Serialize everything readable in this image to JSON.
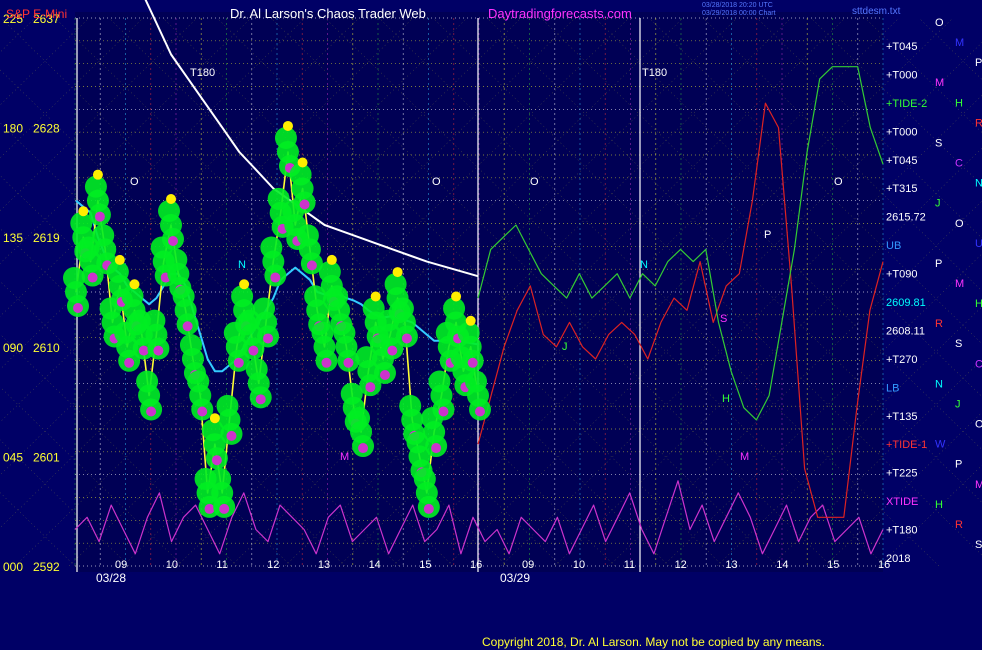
{
  "header": {
    "symbol": "S&P E-Mini",
    "title": "Dr. Al Larson's Chaos Trader Web",
    "site": "Daytradingforecasts.com",
    "stamp1": "03/28/2018 20:20 UTC",
    "stamp2": "03/29/2018 00:00 Chart",
    "file": "sttdesm.txt"
  },
  "footer": {
    "copyright": "Copyright 2018, Dr. Al Larson. May not be copied by any means."
  },
  "y_axis": [
    {
      "deg": "225",
      "price": "2637"
    },
    {
      "deg": "180",
      "price": "2628"
    },
    {
      "deg": "135",
      "price": "2619"
    },
    {
      "deg": "090",
      "price": "2610"
    },
    {
      "deg": "045",
      "price": "2601"
    },
    {
      "deg": "000",
      "price": "2592"
    }
  ],
  "x_axis": {
    "day1": "03/28",
    "day2": "03/29",
    "hours1": [
      "09",
      "10",
      "11",
      "12",
      "13",
      "14",
      "15",
      "16"
    ],
    "hours2": [
      "09",
      "10",
      "11",
      "12",
      "13",
      "14",
      "15",
      "16"
    ]
  },
  "right_labels": [
    {
      "text": "+T045",
      "color": "#ffffff"
    },
    {
      "text": "+T000",
      "color": "#ffffff"
    },
    {
      "text": "+TIDE-2",
      "color": "#33ff33"
    },
    {
      "text": "+T000",
      "color": "#ffffff"
    },
    {
      "text": "+T045",
      "color": "#ffffff"
    },
    {
      "text": "+T315",
      "color": "#ffffff"
    },
    {
      "text": "2615.72",
      "color": "#ffffff"
    },
    {
      "text": "UB",
      "color": "#3399ff"
    },
    {
      "text": "+T090",
      "color": "#ffffff"
    },
    {
      "text": "2609.81",
      "color": "#00ffff"
    },
    {
      "text": "2608.11",
      "color": "#ffffff"
    },
    {
      "text": "+T270",
      "color": "#ffffff"
    },
    {
      "text": "LB",
      "color": "#3399ff"
    },
    {
      "text": "+T135",
      "color": "#ffffff"
    },
    {
      "text": "+TIDE-1",
      "color": "#ff3333"
    },
    {
      "text": "+T225",
      "color": "#ffffff"
    },
    {
      "text": "XTIDE",
      "color": "#ff33ff"
    },
    {
      "text": "+T180",
      "color": "#ffffff"
    },
    {
      "text": "2018",
      "color": "#ffffff"
    }
  ],
  "planet_glyphs": [
    {
      "text": "O",
      "color": "#ffffff"
    },
    {
      "text": "M",
      "color": "#3333ff"
    },
    {
      "text": "P",
      "color": "#ffffff"
    },
    {
      "text": "M",
      "color": "#ff33ff"
    },
    {
      "text": "H",
      "color": "#33ff33"
    },
    {
      "text": "R",
      "color": "#ff3333"
    },
    {
      "text": "S",
      "color": "#ffffff"
    },
    {
      "text": "C",
      "color": "#cc33ff"
    },
    {
      "text": "N",
      "color": "#00ffff"
    },
    {
      "text": "J",
      "color": "#33ff33"
    },
    {
      "text": "O",
      "color": "#ffffff"
    },
    {
      "text": "U",
      "color": "#3333ff"
    },
    {
      "text": "P",
      "color": "#ffffff"
    },
    {
      "text": "M",
      "color": "#ff33ff"
    },
    {
      "text": "H",
      "color": "#33ff33"
    },
    {
      "text": "R",
      "color": "#ff3333"
    },
    {
      "text": "S",
      "color": "#ffffff"
    },
    {
      "text": "C",
      "color": "#cc33ff"
    },
    {
      "text": "N",
      "color": "#00ffff"
    },
    {
      "text": "J",
      "color": "#33ff33"
    },
    {
      "text": "O",
      "color": "#ffffff"
    },
    {
      "text": "W",
      "color": "#3333ff"
    },
    {
      "text": "P",
      "color": "#ffffff"
    },
    {
      "text": "M",
      "color": "#ff33ff"
    },
    {
      "text": "H",
      "color": "#33ff33"
    },
    {
      "text": "R",
      "color": "#ff3333"
    },
    {
      "text": "S",
      "color": "#ffffff"
    }
  ],
  "in_chart_labels": [
    {
      "text": "T180",
      "color": "#ffffff"
    },
    {
      "text": "T180",
      "color": "#ffffff"
    },
    {
      "text": "O",
      "color": "#ffffff"
    },
    {
      "text": "O",
      "color": "#ffffff"
    },
    {
      "text": "O",
      "color": "#ffffff"
    },
    {
      "text": "O",
      "color": "#ffffff"
    },
    {
      "text": "P",
      "color": "#ffffff"
    },
    {
      "text": "N",
      "color": "#00ffff"
    },
    {
      "text": "N",
      "color": "#00ffff"
    },
    {
      "text": "M",
      "color": "#ff33ff"
    },
    {
      "text": "M",
      "color": "#ff33ff"
    },
    {
      "text": "J",
      "color": "#33ff33"
    },
    {
      "text": "H",
      "color": "#33ff33"
    },
    {
      "text": "S",
      "color": "#ff33ff"
    }
  ],
  "chart_data": {
    "type": "line",
    "title": "S&P E-Mini",
    "ylim": [
      2592,
      2637
    ],
    "x_range": [
      "03/28 09:00",
      "03/29 16:00"
    ],
    "grid": true,
    "colors": {
      "background": "#000066",
      "price": "#ffff33",
      "trend_white": "#ffffff",
      "average_cyan": "#33ccff",
      "bubbles": "#00ee22",
      "bubble_marks": "#cc33cc",
      "peaks": "#ffee00",
      "tide1": "#dd2222",
      "tide2": "#33cc33",
      "xtide": "#cc33cc"
    },
    "series": [
      {
        "name": "price",
        "values": [
          2614.5,
          2619,
          2617,
          2622,
          2618,
          2612,
          2615,
          2610,
          2613,
          2611,
          2606,
          2611,
          2617,
          2620,
          2616,
          2613,
          2609,
          2606,
          2598,
          2602,
          2598,
          2604,
          2610,
          2613,
          2611,
          2607,
          2612,
          2617,
          2621,
          2626,
          2620,
          2623,
          2618,
          2613,
          2610,
          2615,
          2613,
          2610,
          2605,
          2603,
          2608,
          2612,
          2609,
          2611,
          2614,
          2612,
          2604,
          2601,
          2598,
          2603,
          2606,
          2610,
          2612,
          2608,
          2610,
          2606
        ]
      },
      {
        "name": "average",
        "values": [
          2622,
          2621.5,
          2621,
          2619,
          2617.5,
          2616.5,
          2616,
          2615,
          2614.5,
          2614,
          2613.5,
          2614,
          2615,
          2616,
          2616,
          2615,
          2613,
          2611,
          2609,
          2608,
          2608,
          2608.5,
          2609,
          2610,
          2611,
          2612,
          2613,
          2614,
          2615.5,
          2616,
          2616.5,
          2616,
          2615.5,
          2614.5,
          2614.3,
          2614.2,
          2614.3,
          2614,
          2613.8,
          2613.5,
          2613,
          2612.6,
          2612.4,
          2612.5,
          2612.4,
          2612.2,
          2612,
          2611.5,
          2611,
          2610.5,
          2610.5,
          2610.6,
          2610.8,
          2610.4,
          2610.3,
          2610.2
        ]
      },
      {
        "name": "trend",
        "values": [
          2642,
          2640,
          2637,
          2634,
          2632,
          2630,
          2628,
          2626,
          2624.5,
          2623,
          2622,
          2621,
          2620,
          2619.5,
          2619,
          2618.5,
          2618,
          2617.5,
          2617,
          2616.6,
          2616.2,
          2615.8
        ]
      },
      {
        "name": "TIDE-2",
        "values": [
          2614,
          2618,
          2619,
          2620,
          2618,
          2616,
          2615,
          2614,
          2616,
          2614,
          2615,
          2616,
          2614,
          2616,
          2615,
          2617,
          2618,
          2617,
          2618,
          2612,
          2608,
          2605,
          2604,
          2606,
          2612,
          2618,
          2626,
          2632,
          2633,
          2633,
          2633,
          2628,
          2625
        ]
      },
      {
        "name": "TIDE-1",
        "values": [
          2602,
          2606,
          2610,
          2613,
          2615,
          2611,
          2610,
          2612,
          2610,
          2609,
          2611,
          2612,
          2611,
          2609,
          2612,
          2614,
          2613,
          2617,
          2612,
          2615,
          2616,
          2622,
          2630,
          2628,
          2615,
          2600,
          2596,
          2596,
          2596,
          2605,
          2613,
          2617
        ]
      },
      {
        "name": "XTIDE",
        "values": [
          2595,
          2596,
          2594,
          2597,
          2595,
          2593,
          2596,
          2598,
          2594,
          2596,
          2597,
          2595,
          2593,
          2596,
          2598,
          2595,
          2594,
          2597,
          2596,
          2595,
          2593,
          2596,
          2597,
          2594,
          2595,
          2596,
          2593,
          2595,
          2597,
          2594,
          2595,
          2597,
          2593,
          2596,
          2594,
          2595,
          2593,
          2596,
          2595,
          2594,
          2596,
          2593,
          2595,
          2597,
          2594,
          2596,
          2598,
          2595,
          2593,
          2596,
          2599,
          2595,
          2597,
          2594,
          2596,
          2598,
          2596,
          2593,
          2595,
          2597,
          2594,
          2596,
          2597,
          2594,
          2595,
          2596,
          2593,
          2595
        ]
      }
    ]
  }
}
